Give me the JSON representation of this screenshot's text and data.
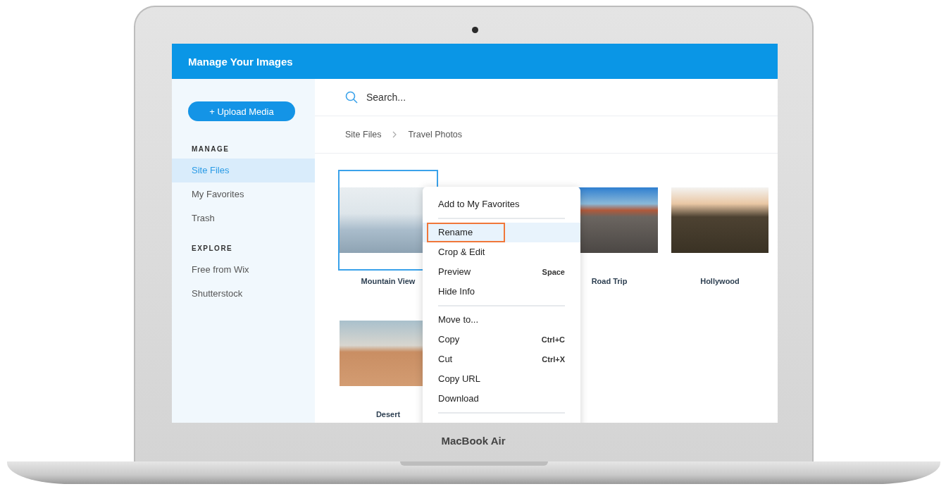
{
  "window": {
    "title": "Manage Your Images"
  },
  "sidebar": {
    "upload_button": "+ Upload Media",
    "sections": [
      {
        "heading": "MANAGE",
        "items": [
          {
            "label": "Site Files",
            "selected": true
          },
          {
            "label": "My Favorites",
            "selected": false
          },
          {
            "label": "Trash",
            "selected": false
          }
        ]
      },
      {
        "heading": "EXPLORE",
        "items": [
          {
            "label": "Free from Wix",
            "selected": false
          },
          {
            "label": "Shutterstock",
            "selected": false
          }
        ]
      }
    ]
  },
  "search": {
    "placeholder": "Search..."
  },
  "breadcrumbs": [
    "Site Files",
    "Travel Photos"
  ],
  "images": [
    {
      "name": "Mountain View",
      "kind": "mountain",
      "selected": true
    },
    {
      "name": "Road Trip",
      "kind": "road",
      "selected": false
    },
    {
      "name": "Hollywood",
      "kind": "hills",
      "selected": false
    },
    {
      "name": "Desert",
      "kind": "desert",
      "selected": false
    }
  ],
  "context_menu": {
    "groups": [
      [
        {
          "label": "Add to My Favorites",
          "selected": false
        }
      ],
      [
        {
          "label": "Rename",
          "selected": true
        },
        {
          "label": "Crop & Edit",
          "selected": false
        },
        {
          "label": "Preview",
          "shortcut": "Space",
          "selected": false
        },
        {
          "label": "Hide Info",
          "selected": false
        }
      ],
      [
        {
          "label": "Move to...",
          "selected": false
        },
        {
          "label": "Copy",
          "shortcut": "Ctrl+C",
          "selected": false
        },
        {
          "label": "Cut",
          "shortcut": "Ctrl+X",
          "selected": false
        },
        {
          "label": "Copy URL",
          "selected": false
        },
        {
          "label": "Download",
          "selected": false
        }
      ]
    ]
  },
  "device": {
    "label": "MacBook Air"
  }
}
